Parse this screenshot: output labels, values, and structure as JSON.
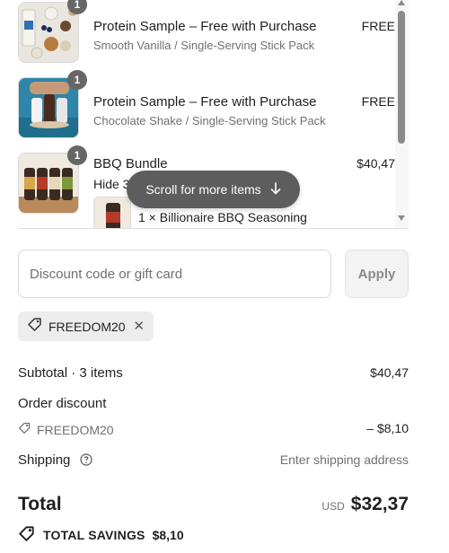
{
  "items": [
    {
      "quantity": "1",
      "title": "Protein Sample – Free with Purchase",
      "variant": "Smooth Vanilla / Single-Serving Stick Pack",
      "price": "FREE"
    },
    {
      "quantity": "1",
      "title": "Protein Sample – Free with Purchase",
      "variant": "Chocolate Shake / Single-Serving Stick Pack",
      "price": "FREE"
    },
    {
      "quantity": "1",
      "title": "BBQ Bundle",
      "variant": "Hide 3",
      "price": "$40,47",
      "sub_item": "1 × Billionaire BBQ Seasoning"
    }
  ],
  "scroll_hint": "Scroll for more items",
  "discount": {
    "placeholder": "Discount code or gift card",
    "apply_label": "Apply",
    "applied_code": "FREEDOM20"
  },
  "summary": {
    "subtotal_label": "Subtotal · 3 items",
    "subtotal_value": "$40,47",
    "order_discount_label": "Order discount",
    "discount_code": "FREEDOM20",
    "discount_value": "– $8,10",
    "shipping_label": "Shipping",
    "shipping_value": "Enter shipping address",
    "total_label": "Total",
    "currency": "USD",
    "total_value": "$32,37",
    "savings_label": "TOTAL SAVINGS",
    "savings_value": "$8,10"
  },
  "icons": {
    "tag": "tag-icon",
    "close": "close-icon",
    "help": "help-circle-icon",
    "arrow": "arrow-down-icon"
  }
}
